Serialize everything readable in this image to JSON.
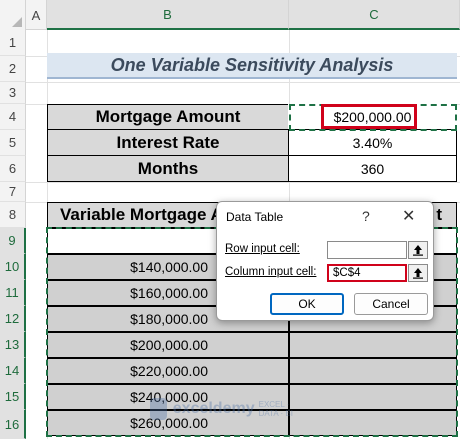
{
  "columns": [
    "A",
    "B",
    "C"
  ],
  "rows": [
    "1",
    "2",
    "3",
    "4",
    "5",
    "6",
    "7",
    "8",
    "9",
    "10",
    "11",
    "12",
    "13",
    "14",
    "15",
    "16"
  ],
  "title": "One Variable Sensitivity Analysis",
  "inputs": {
    "mortgage_label": "Mortgage Amount",
    "mortgage_value": "$200,000.00",
    "rate_label": "Interest Rate",
    "rate_value": "3.40%",
    "months_label": "Months",
    "months_value": "360"
  },
  "table_header": {
    "b": "Variable Mortgage A",
    "c_partial": "t"
  },
  "data_rows": [
    "$140,000.00",
    "$160,000.00",
    "$180,000.00",
    "$200,000.00",
    "$220,000.00",
    "$240,000.00",
    "$260,000.00"
  ],
  "dialog": {
    "title": "Data Table",
    "help": "?",
    "close": "✕",
    "row_label": "Row input cell:",
    "row_value": "",
    "col_label": "Column input cell:",
    "col_value": "$C$4",
    "ok": "OK",
    "cancel": "Cancel"
  },
  "watermark": {
    "name": "exceldemy",
    "tagline": "EXCEL · DATA · BI"
  },
  "colors": {
    "accent_green": "#1e7145",
    "highlight_red": "#d0021b",
    "title_bg": "#dce6f1"
  }
}
